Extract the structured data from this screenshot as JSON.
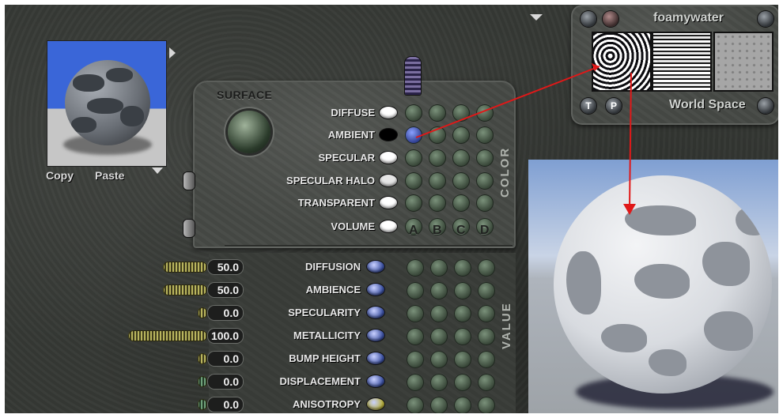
{
  "preview": {
    "copy_label": "Copy",
    "paste_label": "Paste"
  },
  "surface": {
    "title": "SURFACE",
    "color_label": "COLOR",
    "value_label": "VALUE",
    "columns": [
      "A",
      "B",
      "C",
      "D"
    ],
    "color_rows": [
      {
        "label": "DIFFUSE",
        "swatch": "#ffffff"
      },
      {
        "label": "AMBIENT",
        "swatch": "#000000"
      },
      {
        "label": "SPECULAR",
        "swatch": "#ffffff"
      },
      {
        "label": "SPECULAR HALO",
        "swatch": "#e6e6e6"
      },
      {
        "label": "TRANSPARENT",
        "swatch": "#ffffff"
      },
      {
        "label": "VOLUME",
        "swatch": "#ffffff"
      }
    ],
    "value_rows": [
      {
        "label": "DIFFUSION",
        "value": "50.0",
        "level": 0.5,
        "slider": "yellow",
        "dot": "#3a4fa0"
      },
      {
        "label": "AMBIENCE",
        "value": "50.0",
        "level": 0.5,
        "slider": "yellow",
        "dot": "#3a4fa0"
      },
      {
        "label": "SPECULARITY",
        "value": "0.0",
        "level": 0.0,
        "slider": "yellow",
        "dot": "#3a4fa0"
      },
      {
        "label": "METALLICITY",
        "value": "100.0",
        "level": 1.0,
        "slider": "yellow",
        "dot": "#3a4fa0"
      },
      {
        "label": "BUMP HEIGHT",
        "value": "0.0",
        "level": 0.0,
        "slider": "yellow",
        "dot": "#3a4fa0"
      },
      {
        "label": "DISPLACEMENT",
        "value": "0.0",
        "level": 0.0,
        "slider": "green",
        "dot": "#3a4fa0"
      },
      {
        "label": "ANISOTROPY",
        "value": "0.0",
        "level": 0.0,
        "slider": "green",
        "dot": "#b8b03a"
      }
    ]
  },
  "texture": {
    "name": "foamywater",
    "space": "World Space",
    "left_button": "T",
    "right_button": "P"
  },
  "colors": {
    "connection_arrow": "#e01818",
    "ambient_link_dot": "#2b3a8a"
  }
}
